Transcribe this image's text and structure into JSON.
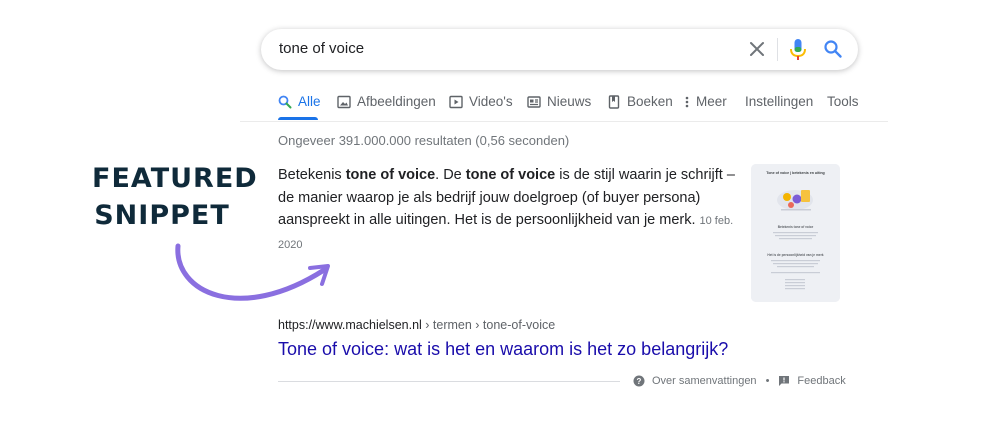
{
  "annotation": {
    "line1": "FEATURED",
    "line2": "SNIPPET"
  },
  "search": {
    "query": "tone of voice"
  },
  "tabs": [
    {
      "label": "Alle",
      "icon": "search-icon",
      "active": true
    },
    {
      "label": "Afbeeldingen",
      "icon": "image-icon"
    },
    {
      "label": "Video's",
      "icon": "video-icon"
    },
    {
      "label": "Nieuws",
      "icon": "news-icon"
    },
    {
      "label": "Boeken",
      "icon": "book-icon"
    },
    {
      "label": "Meer",
      "icon": "more-vert-icon"
    },
    {
      "label": "Instellingen"
    },
    {
      "label": "Tools"
    }
  ],
  "stats": "Ongeveer 391.000.000 resultaten (0,56 seconden)",
  "snippet": {
    "t1": "Betekenis ",
    "b1": "tone of voice",
    "t2": ". De ",
    "b2": "tone of voice",
    "t3": " is de stijl waarin je schrijft – de manier waarop je als bedrijf jouw doelgroep (of buyer persona) aanspreekt in alle uitingen. Het is de persoonlijkheid van je merk.",
    "date": "10 feb. 2020"
  },
  "thumbnail": {
    "title": "Tone of voice | betekenis en uiting",
    "heading1": "Betekenis tone of voice",
    "heading2": "Het is de persoonlijkheid van je merk"
  },
  "result": {
    "domain": "https://www.machielsen.nl",
    "breadcrumb": " › termen › tone-of-voice",
    "title": "Tone of voice: wat is het en waarom is het zo belangrijk?"
  },
  "footer": {
    "about": "Over samenvattingen",
    "separator": "•",
    "feedback": "Feedback"
  },
  "colors": {
    "link": "#1a0dab",
    "accent": "#1a73e8",
    "arrow": "#8a6fe0",
    "annotation": "#0f2a3a"
  }
}
